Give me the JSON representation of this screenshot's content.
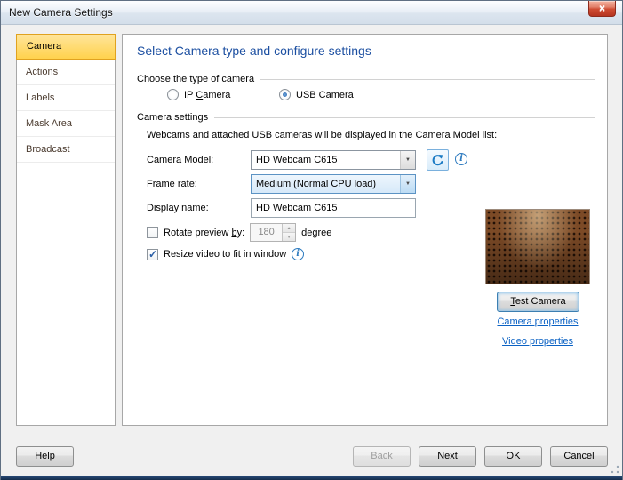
{
  "window": {
    "title": "New Camera Settings"
  },
  "icons": {
    "close": "×",
    "dropdown": "▼",
    "spin_up": "▲",
    "spin_down": "▼",
    "info": "i"
  },
  "sidebar": {
    "items": [
      {
        "label": "Camera",
        "selected": true
      },
      {
        "label": "Actions",
        "selected": false
      },
      {
        "label": "Labels",
        "selected": false
      },
      {
        "label": "Mask Area",
        "selected": false
      },
      {
        "label": "Broadcast",
        "selected": false
      }
    ]
  },
  "main": {
    "heading": "Select Camera type and configure settings",
    "type_group": {
      "label": "Choose the type of camera",
      "ip": {
        "pre": "IP ",
        "key": "C",
        "post": "amera",
        "selected": false
      },
      "usb": {
        "label": "USB Camera",
        "selected": true
      }
    },
    "settings_group": {
      "label": "Camera settings",
      "description": "Webcams and attached USB cameras will be displayed in the Camera Model list:",
      "camera_model": {
        "pre": "Camera ",
        "key": "M",
        "post": "odel:",
        "value": "HD Webcam C615"
      },
      "frame_rate": {
        "pre": "",
        "key": "F",
        "post": "rame rate:",
        "value": "Medium (Normal CPU load)"
      },
      "display_name": {
        "label": "Display name:",
        "value": "HD Webcam C615"
      },
      "rotate": {
        "pre": "Rotate preview ",
        "key": "b",
        "post": "y:",
        "value": "180",
        "suffix": "degree",
        "checked": false
      },
      "resize": {
        "label": "Resize video to fit in window",
        "checked": true
      }
    },
    "preview": {
      "test_button": {
        "key": "T",
        "post": "est Camera"
      },
      "links": [
        {
          "label": "Camera properties"
        },
        {
          "label": "Video properties"
        }
      ]
    }
  },
  "footer": {
    "help": "Help",
    "back": "Back",
    "next": "Next",
    "ok": "OK",
    "cancel": "Cancel"
  },
  "colors": {
    "sidebar_selected": "#ffd24d",
    "heading": "#1c4fa1",
    "link": "#0b62c4",
    "accent_blue": "#2e7bbf"
  }
}
